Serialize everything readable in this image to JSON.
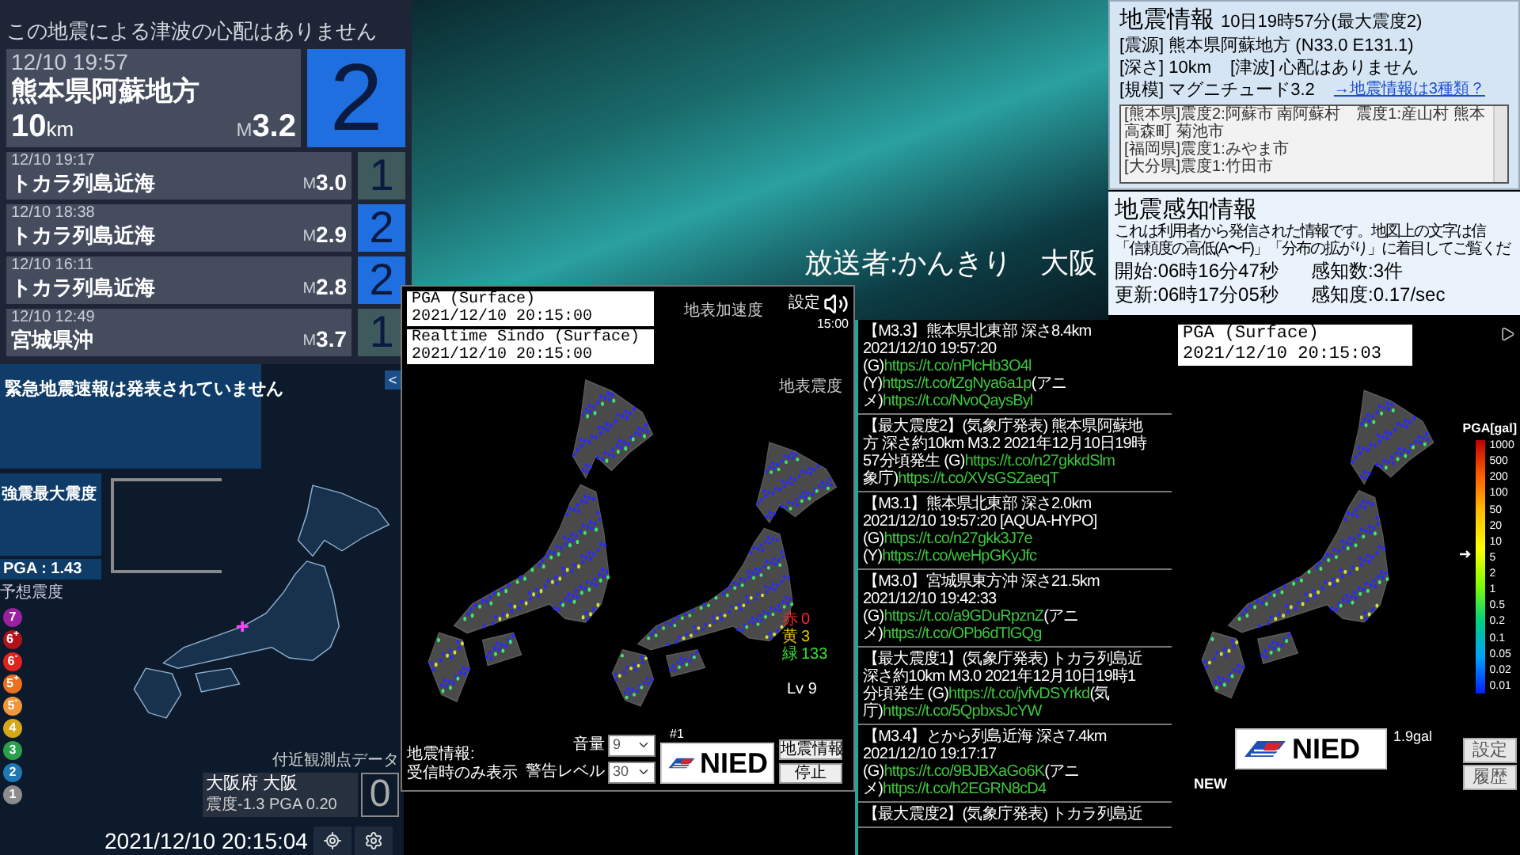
{
  "left_panel": {
    "tsunami_message": "この地震による津波の心配はありません",
    "latest": {
      "time": "12/10 19:57",
      "place": "熊本県阿蘇地方",
      "depth": "10",
      "depth_unit": "km",
      "mag_prefix": "M",
      "magnitude": "3.2",
      "intensity": "2",
      "color": "#1f6fe0"
    },
    "history": [
      {
        "time": "12/10 19:17",
        "place": "トカラ列島近海",
        "mag_prefix": "M",
        "magnitude": "3.0",
        "intensity": "1",
        "color": "#3e5a5c"
      },
      {
        "time": "12/10 18:38",
        "place": "トカラ列島近海",
        "mag_prefix": "M",
        "magnitude": "2.9",
        "intensity": "2",
        "color": "#1f6fe0"
      },
      {
        "time": "12/10 16:11",
        "place": "トカラ列島近海",
        "mag_prefix": "M",
        "magnitude": "2.8",
        "intensity": "2",
        "color": "#1f6fe0"
      },
      {
        "time": "12/10 12:49",
        "place": "宮城県沖",
        "mag_prefix": "M",
        "magnitude": "3.7",
        "intensity": "1",
        "color": "#3e5a5c"
      }
    ]
  },
  "eew_panel": {
    "status": "緊急地震速報は発表されていません",
    "collapse": "<",
    "max_label": "強震最大震度",
    "pga": "PGA : 1.43",
    "forecast_label": "予想震度",
    "legend": [
      {
        "label": "7",
        "color": "#9b1fa0"
      },
      {
        "label": "6$^{+}$",
        "color": "#b3121b"
      },
      {
        "label": "6$^{-}$",
        "color": "#e0231c"
      },
      {
        "label": "5$^{+}$",
        "color": "#e8701e"
      },
      {
        "label": "5$^{-}$",
        "color": "#f2963a"
      },
      {
        "label": "4",
        "color": "#d6a818"
      },
      {
        "label": "3",
        "color": "#2aa04a"
      },
      {
        "label": "2",
        "color": "#1f78b4"
      },
      {
        "label": "1",
        "color": "#8c8c8c"
      }
    ],
    "nearby_title": "付近観測点データ",
    "station": "大阪府 大阪",
    "station_reading": "震度-1.3 PGA 0.20",
    "station_intensity": "0",
    "datetime": "2021/12/10 20:15:04"
  },
  "broadcaster": "放送者:かんきり　大阪",
  "kmoni_window": {
    "pga_title": "PGA (Surface)",
    "pga_time": "2021/12/10 20:15:00",
    "sindo_title": "Realtime Sindo (Surface)",
    "sindo_time": "2021/12/10 20:15:00",
    "pga_map_label": "地表加速度",
    "sindo_map_label": "地表震度",
    "settings": "設定",
    "clock": "15:00",
    "counts": [
      {
        "label": "赤",
        "value": "0",
        "color": "#ff2a2a"
      },
      {
        "label": "黄",
        "value": "3",
        "color": "#e8c400"
      },
      {
        "label": "緑",
        "value": "133",
        "color": "#33e033"
      }
    ],
    "level_text": "Lv 9",
    "channel": "#1",
    "notice_lines": [
      "地震情報:",
      "受信時のみ表示"
    ],
    "volume_label": "音量",
    "volume": "9",
    "warn_label": "警告レベル",
    "warn": "30",
    "logo_text": "NIED",
    "buttons": [
      "地震情報",
      "停止"
    ]
  },
  "tweets": [
    {
      "lines": [
        [
          {
            "kind": "text",
            "text": "【M3.3】熊本県北東部 深さ8.4km"
          }
        ],
        [
          {
            "kind": "text",
            "text": "2021/12/10 19:57:20"
          }
        ],
        [
          {
            "kind": "text",
            "text": "(G)"
          },
          {
            "kind": "link",
            "text": "https://t.co/nPlcHb3O4l"
          }
        ],
        [
          {
            "kind": "text",
            "text": "(Y)"
          },
          {
            "kind": "link",
            "text": "https://t.co/tZgNya6a1p"
          },
          {
            "kind": "text",
            "text": "(アニ"
          }
        ],
        [
          {
            "kind": "text",
            "text": "メ)"
          },
          {
            "kind": "link",
            "text": "https://t.co/NvoQaysByl"
          }
        ]
      ]
    },
    {
      "lines": [
        [
          {
            "kind": "text",
            "text": "【最大震度2】(気象庁発表) 熊本県阿蘇地"
          }
        ],
        [
          {
            "kind": "text",
            "text": "方 深さ約10km M3.2 2021年12月10日19時"
          }
        ],
        [
          {
            "kind": "text",
            "text": "57分頃発生 (G)"
          },
          {
            "kind": "link",
            "text": "https://t.co/n27gkkdSlm"
          }
        ],
        [
          {
            "kind": "text",
            "text": "象庁)"
          },
          {
            "kind": "link",
            "text": "https://t.co/XVsGSZaeqT"
          }
        ]
      ]
    },
    {
      "lines": [
        [
          {
            "kind": "text",
            "text": "【M3.1】熊本県北東部 深さ2.0km"
          }
        ],
        [
          {
            "kind": "text",
            "text": "2021/12/10 19:57:20 [AQUA-HYPO]"
          }
        ],
        [
          {
            "kind": "text",
            "text": "(G)"
          },
          {
            "kind": "link",
            "text": "https://t.co/n27gkk3J7e"
          }
        ],
        [
          {
            "kind": "text",
            "text": "(Y)"
          },
          {
            "kind": "link",
            "text": "https://t.co/weHpGKyJfc"
          }
        ]
      ]
    },
    {
      "lines": [
        [
          {
            "kind": "text",
            "text": "【M3.0】宮城県東方沖 深さ21.5km"
          }
        ],
        [
          {
            "kind": "text",
            "text": "2021/12/10 19:42:33"
          }
        ],
        [
          {
            "kind": "text",
            "text": "(G)"
          },
          {
            "kind": "link",
            "text": "https://t.co/a9GDuRpznZ"
          },
          {
            "kind": "text",
            "text": "(アニ"
          }
        ],
        [
          {
            "kind": "text",
            "text": "メ)"
          },
          {
            "kind": "link",
            "text": "https://t.co/OPb6dTlGQg"
          }
        ]
      ]
    },
    {
      "lines": [
        [
          {
            "kind": "text",
            "text": "【最大震度1】(気象庁発表) トカラ列島近"
          }
        ],
        [
          {
            "kind": "text",
            "text": "深さ約10km M3.0 2021年12月10日19時1"
          }
        ],
        [
          {
            "kind": "text",
            "text": "分頃発生 (G)"
          },
          {
            "kind": "link",
            "text": "https://t.co/jvfvDSYrkd"
          },
          {
            "kind": "text",
            "text": "(気"
          }
        ],
        [
          {
            "kind": "text",
            "text": "庁)"
          },
          {
            "kind": "link",
            "text": "https://t.co/5QpbxsJcYW"
          }
        ]
      ]
    },
    {
      "lines": [
        [
          {
            "kind": "text",
            "text": "【M3.4】とから列島近海 深さ7.4km"
          }
        ],
        [
          {
            "kind": "text",
            "text": "2021/12/10 19:17:17"
          }
        ],
        [
          {
            "kind": "text",
            "text": "(G)"
          },
          {
            "kind": "link",
            "text": "https://t.co/9BJBXaGo6K"
          },
          {
            "kind": "text",
            "text": "(アニ"
          }
        ],
        [
          {
            "kind": "text",
            "text": "メ)"
          },
          {
            "kind": "link",
            "text": "https://t.co/h2EGRN8cD4"
          }
        ]
      ]
    },
    {
      "lines": [
        [
          {
            "kind": "text",
            "text": "【最大震度2】(気象庁発表) トカラ列島近"
          }
        ]
      ]
    }
  ],
  "quake_info": {
    "title": "地震情報",
    "subtitle": "10日19時57分(最大震度2)",
    "rows": [
      [
        {
          "label": "[震源]",
          "value": "熊本県阿蘇地方 (N33.0 E131.1)"
        }
      ],
      [
        {
          "label": "[深さ]",
          "value": "10km"
        },
        {
          "label": "[津波]",
          "value": "心配はありません"
        }
      ],
      [
        {
          "label": "[規模]",
          "value": "マグニチュード3.2"
        }
      ]
    ],
    "link": "→地震情報は3種類？",
    "details": [
      "[熊本県]震度2:阿蘇市 南阿蘇村　震度1:産山村 熊本高森町 菊池市",
      "[福岡県]震度1:みやま市",
      "[大分県]震度1:竹田市"
    ]
  },
  "sensing": {
    "title": "地震感知情報",
    "lines": [
      "これは利用者から発信された情報です。地図上の文字は信",
      "「信頼度の高低(A〜F)」「分布の拡がり」に着目してご覧くだ"
    ],
    "stats": [
      "開始:06時16分47秒",
      "感知数:3件",
      "更新:06時17分05秒",
      "感知度:0.17/sec"
    ]
  },
  "pga_window": {
    "title": "PGA (Surface)",
    "time": "2021/12/10 20:15:03",
    "scale_title": "PGA[gal]",
    "scale": [
      "1000",
      "500",
      "200",
      "100",
      "50",
      "20",
      "10",
      "5",
      "2",
      "1",
      "0.5",
      "0.2",
      "0.1",
      "0.05",
      "0.02",
      "0.01"
    ],
    "level": 0.55,
    "reading": "1.9gal",
    "new_label": "NEW",
    "logo_text": "NIED",
    "buttons": [
      "設定",
      "履歴"
    ]
  }
}
